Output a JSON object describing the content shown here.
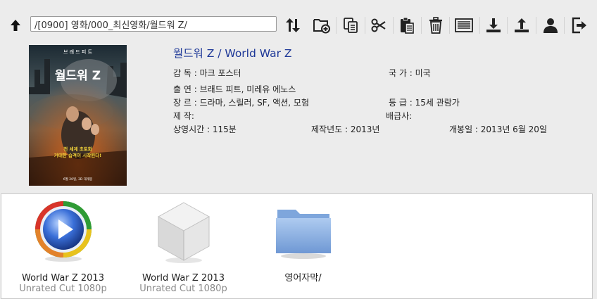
{
  "toolbar": {
    "path_value": "/[0900] 영화/000_최신영화/월드워 Z/",
    "icons": [
      "up-arrow-icon",
      "refresh-icon",
      "new-folder-icon",
      "copy-icon",
      "cut-icon",
      "paste-icon",
      "delete-icon",
      "view-list-icon",
      "download-icon",
      "upload-icon",
      "user-icon",
      "logout-icon"
    ]
  },
  "poster": {
    "top_text": "브 래 드   피 트",
    "logo_text": "월드워 Z",
    "tagline_1": "전 세계 초토화",
    "tagline_2": "거대한 습격이 시작된다!",
    "date_text": "6월 20일, 3D 대개봉"
  },
  "movie": {
    "title": "월드워 Z / World War Z",
    "director": "감 독 : 마크 포스터",
    "country": "국 가 : 미국",
    "cast": "출 연 : 브래드 피트, 미레유 에노스",
    "genre": "장 르 : 드라마, 스릴러, SF, 액션, 모험",
    "rating": "등 급 : 15세 관람가",
    "production": "제 작:",
    "distributor": "배급사:",
    "runtime": "상영시간 : 115분",
    "year": "제작년도 : 2013년",
    "release": "개봉일 : 2013년 6월 20일"
  },
  "files": [
    {
      "name": "World War Z 2013",
      "sub": "Unrated Cut 1080p",
      "icon": "media-player-icon"
    },
    {
      "name": "World War Z 2013",
      "sub": "Unrated Cut 1080p",
      "icon": "package-box-icon"
    },
    {
      "name": "영어자막/",
      "sub": "",
      "icon": "folder-icon"
    }
  ]
}
